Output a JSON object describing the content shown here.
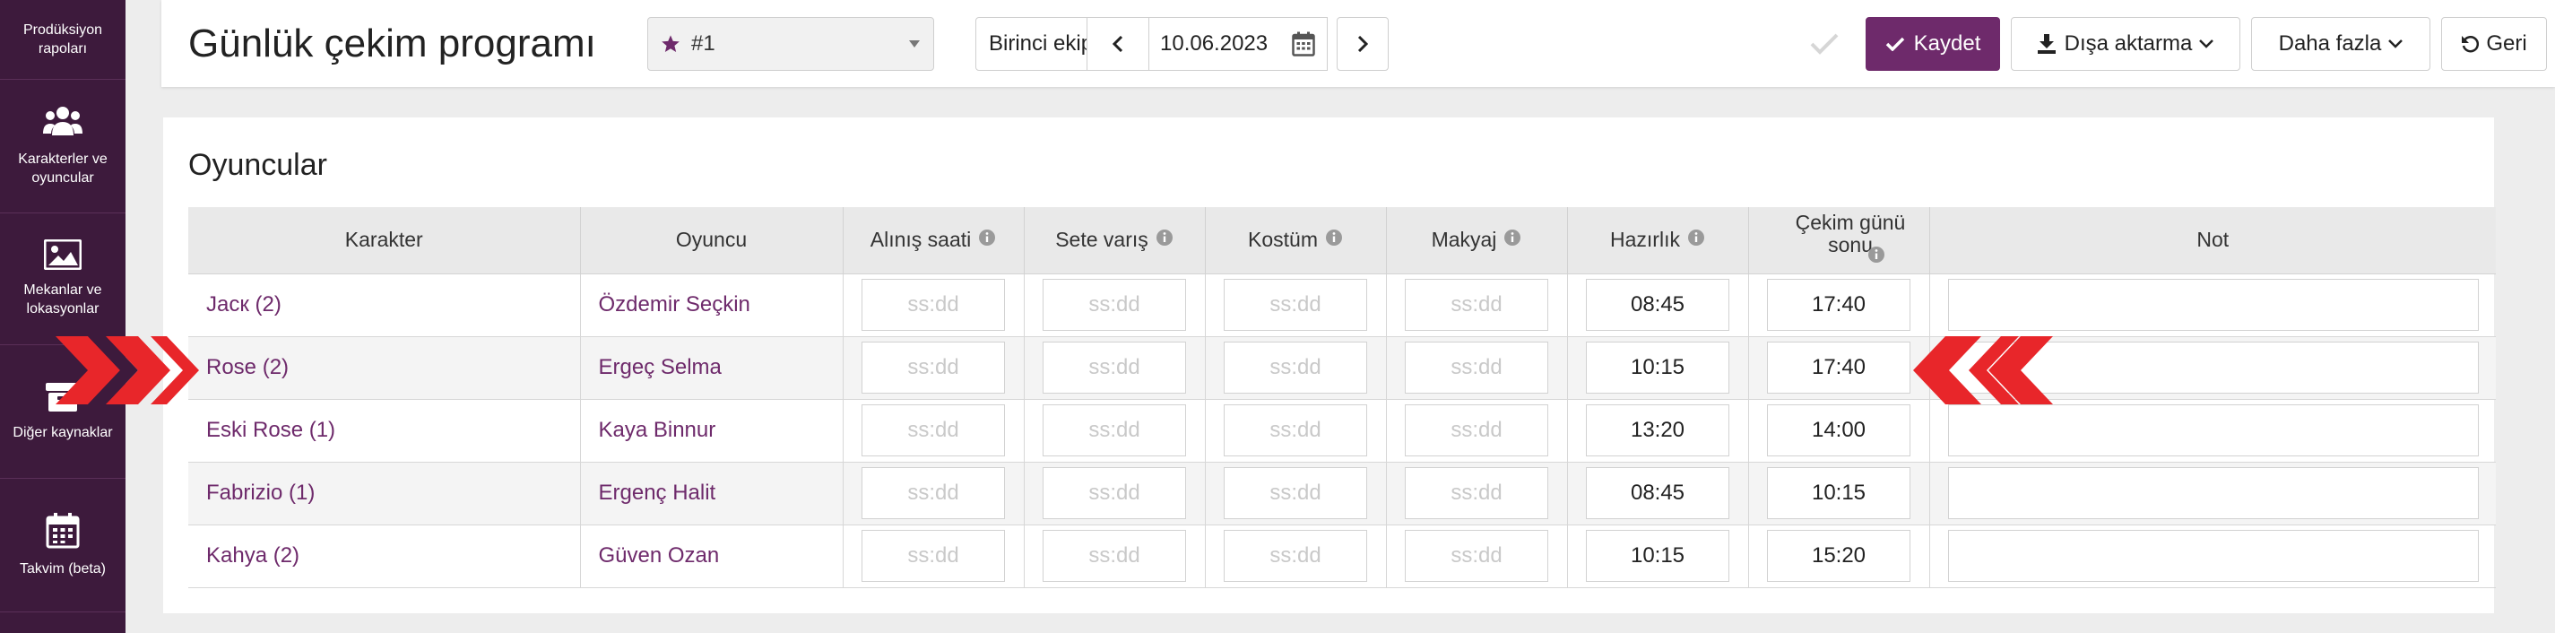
{
  "sidebar": {
    "items": [
      {
        "label": "Prodüksiyon rapoları",
        "icon": "document-icon"
      },
      {
        "label": "Karakterler ve oyuncular",
        "icon": "users-icon"
      },
      {
        "label": "Mekanlar ve lokasyonlar",
        "icon": "image-icon"
      },
      {
        "label": "Diğer kaynaklar",
        "icon": "box-icon"
      },
      {
        "label": "Takvim (beta)",
        "icon": "calendar-icon"
      }
    ]
  },
  "header": {
    "title": "Günlük çekim programı",
    "program_select": {
      "value": "#1",
      "icon": "star-icon"
    },
    "unit": "Birinci ekip",
    "date": "10.06.2023",
    "save_label": "Kaydet",
    "export_label": "Dışa aktarma",
    "more_label": "Daha fazla",
    "back_label": "Geri"
  },
  "section": {
    "title": "Oyuncular"
  },
  "table": {
    "headers": [
      "Karakter",
      "Oyuncu",
      "Alınış saati",
      "Sete varış",
      "Kostüm",
      "Makyaj",
      "Hazırlık",
      "Çekim günü sonu",
      "Not"
    ],
    "time_placeholder": "ss:dd",
    "rows": [
      {
        "character": "Jacк (2)",
        "actor": "Özdemir Seçkin",
        "pickup": "",
        "arrival": "",
        "costume": "",
        "makeup": "",
        "ready": "08:45",
        "wrap": "17:40",
        "note": ""
      },
      {
        "character": "Rose (2)",
        "actor": "Ergeç Selma",
        "pickup": "",
        "arrival": "",
        "costume": "",
        "makeup": "",
        "ready": "10:15",
        "wrap": "17:40",
        "note": ""
      },
      {
        "character": "Eski Rose (1)",
        "actor": "Kaya Binnur",
        "pickup": "",
        "arrival": "",
        "costume": "",
        "makeup": "",
        "ready": "13:20",
        "wrap": "14:00",
        "note": ""
      },
      {
        "character": "Fabrizio (1)",
        "actor": "Ergenç Halit",
        "pickup": "",
        "arrival": "",
        "costume": "",
        "makeup": "",
        "ready": "08:45",
        "wrap": "10:15",
        "note": ""
      },
      {
        "character": "Kahya (2)",
        "actor": "Güven Ozan",
        "pickup": "",
        "arrival": "",
        "costume": "",
        "makeup": "",
        "ready": "10:15",
        "wrap": "15:20",
        "note": ""
      }
    ]
  },
  "colors": {
    "sidebar_bg": "#3d1a3c",
    "accent": "#6e2a6b",
    "marker_red": "#e8262a"
  }
}
